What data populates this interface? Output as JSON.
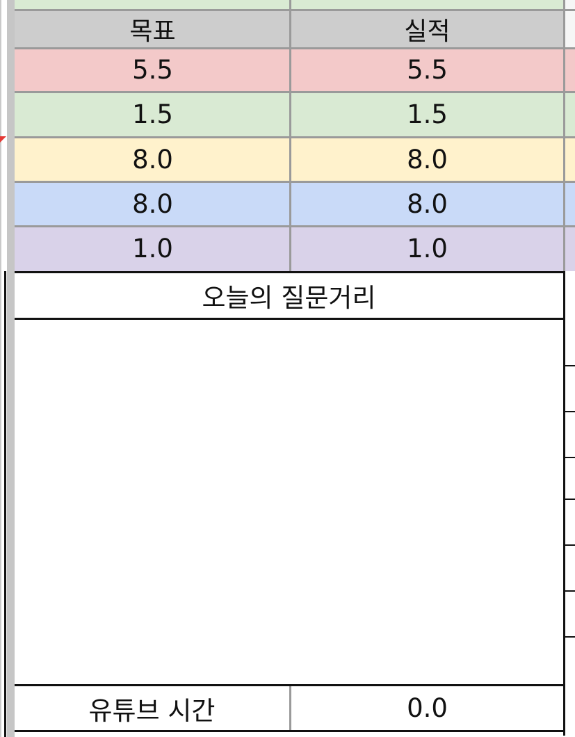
{
  "colors": {
    "header_bg": "#cdcdcd",
    "row_red": "#f3c9c9",
    "row_green": "#d9ead3",
    "row_yellow": "#fff2cc",
    "row_blue": "#c9daf8",
    "row_purple": "#d9d2e9",
    "grid": "#9a9a9a",
    "border": "#111111",
    "marker": "#e53935"
  },
  "table": {
    "header": {
      "target_label": "목표",
      "actual_label": "실적"
    },
    "rows": [
      {
        "target": "5.5",
        "actual": "5.5"
      },
      {
        "target": "1.5",
        "actual": "1.5"
      },
      {
        "target": "8.0",
        "actual": "8.0"
      },
      {
        "target": "8.0",
        "actual": "8.0"
      },
      {
        "target": "1.0",
        "actual": "1.0"
      }
    ]
  },
  "questions": {
    "title": "오늘의 질문거리",
    "body": ""
  },
  "youtube": {
    "label": "유튜브 시간",
    "value": "0.0"
  }
}
